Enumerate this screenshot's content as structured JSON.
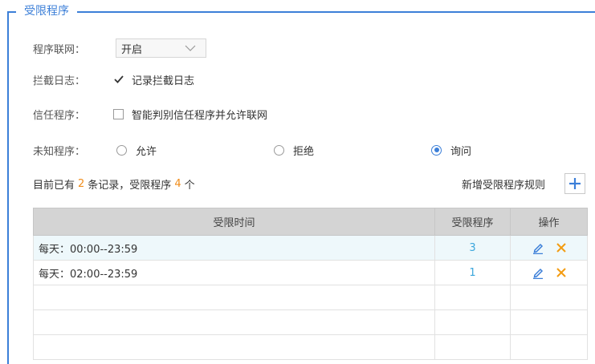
{
  "section": {
    "title": "受限程序"
  },
  "network": {
    "label": "程序联网：",
    "value": "开启"
  },
  "intercept_log": {
    "label": "拦截日志：",
    "checkbox_label": "记录拦截日志",
    "checked": true
  },
  "trusted": {
    "label": "信任程序：",
    "checkbox_label": "智能判别信任程序并允许联网",
    "checked": false
  },
  "unknown": {
    "label": "未知程序：",
    "options": [
      {
        "label": "允许",
        "selected": false
      },
      {
        "label": "拒绝",
        "selected": false
      },
      {
        "label": "询问",
        "selected": true
      }
    ]
  },
  "summary": {
    "prefix": "目前已有",
    "records": "2",
    "middle": "条记录，受限程序",
    "programs": "4",
    "suffix": "个"
  },
  "add_rule": {
    "label": "新增受限程序规则"
  },
  "table": {
    "headers": [
      "受限时间",
      "受限程序",
      "操作"
    ],
    "rows": [
      {
        "time": "每天：00:00--23:59",
        "count": "3"
      },
      {
        "time": "每天：02:00--23:59",
        "count": "1"
      }
    ]
  },
  "colors": {
    "accent": "#3c7fd8",
    "highlight_number": "#f08c1a",
    "count_text": "#3ba6dc",
    "delete_icon": "#f39c12"
  }
}
